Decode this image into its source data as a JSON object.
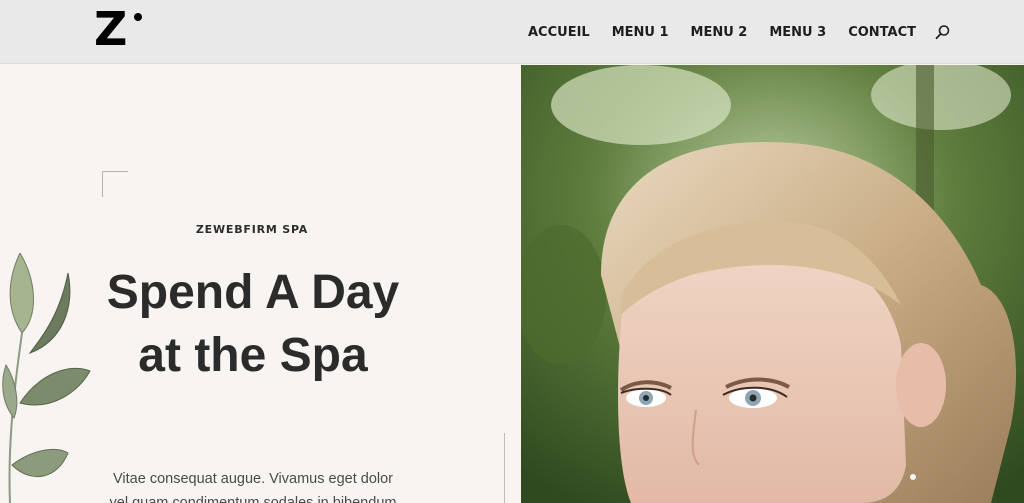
{
  "header": {
    "logo_alt": "Z•",
    "nav": [
      "ACCUEIL",
      "MENU 1",
      "MENU 2",
      "MENU 3",
      "CONTACT"
    ]
  },
  "hero": {
    "eyebrow": "ZEWEBFIRM SPA",
    "title": "Spend A Day at the Spa",
    "body": "Vitae consequat augue. Vivamus eget dolor vel quam condimentum sodales in bibendum"
  },
  "icons": {
    "search": "search-icon",
    "leaves": "leaf-branch-illustration"
  },
  "colors": {
    "header_bg": "#e9e9e9",
    "page_bg": "#f8f4f2",
    "text": "#2b2b2b"
  }
}
